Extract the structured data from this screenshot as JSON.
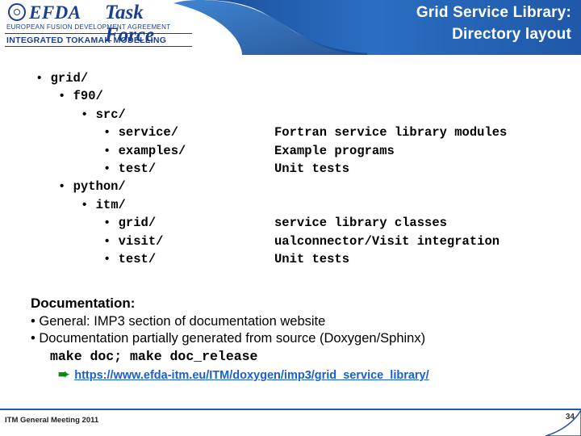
{
  "header": {
    "title_line1": "Grid Service Library:",
    "title_line2": "Directory layout",
    "logo": {
      "brand": "EFDA",
      "task_force": "Task Force",
      "subtitle": "EUROPEAN FUSION DEVELOPMENT AGREEMENT",
      "program": "INTEGRATED TOKAMAK MODELLING",
      "eu_icon": "eu-stars-icon"
    },
    "accent_color": "#1b3f8f",
    "banner_color": "#2f6fc4"
  },
  "tree": {
    "bullet": "•",
    "rows": [
      {
        "indent": 0,
        "label": "grid/",
        "desc": ""
      },
      {
        "indent": 1,
        "label": "f90/",
        "desc": ""
      },
      {
        "indent": 2,
        "label": "src/",
        "desc": ""
      },
      {
        "indent": 3,
        "label": "service/",
        "desc": "Fortran service library modules"
      },
      {
        "indent": 3,
        "label": "examples/",
        "desc": "Example programs"
      },
      {
        "indent": 3,
        "label": "test/",
        "desc": "Unit tests"
      },
      {
        "indent": 1,
        "label": "python/",
        "desc": ""
      },
      {
        "indent": 2,
        "label": "itm/",
        "desc": ""
      },
      {
        "indent": 3,
        "label": "grid/",
        "desc": "service library classes"
      },
      {
        "indent": 3,
        "label": "visit/",
        "desc": "ualconnector/Visit integration"
      },
      {
        "indent": 3,
        "label": "test/",
        "desc": "Unit tests"
      }
    ]
  },
  "documentation": {
    "heading": "Documentation:",
    "bullets": [
      "• General: IMP3 section of documentation website",
      "• Documentation partially generated from source (Doxygen/Sphinx)"
    ],
    "commands": "make doc; make doc_release",
    "arrow": "➨",
    "link": "https://www.efda-itm.eu/ITM/doxygen/imp3/grid_service_library/",
    "link_color": "#1a5fd0",
    "arrow_color": "#0f8a0f"
  },
  "footer": {
    "meeting": "ITM General Meeting 2011",
    "page_number": "34",
    "rule_color": "#2756a8"
  }
}
